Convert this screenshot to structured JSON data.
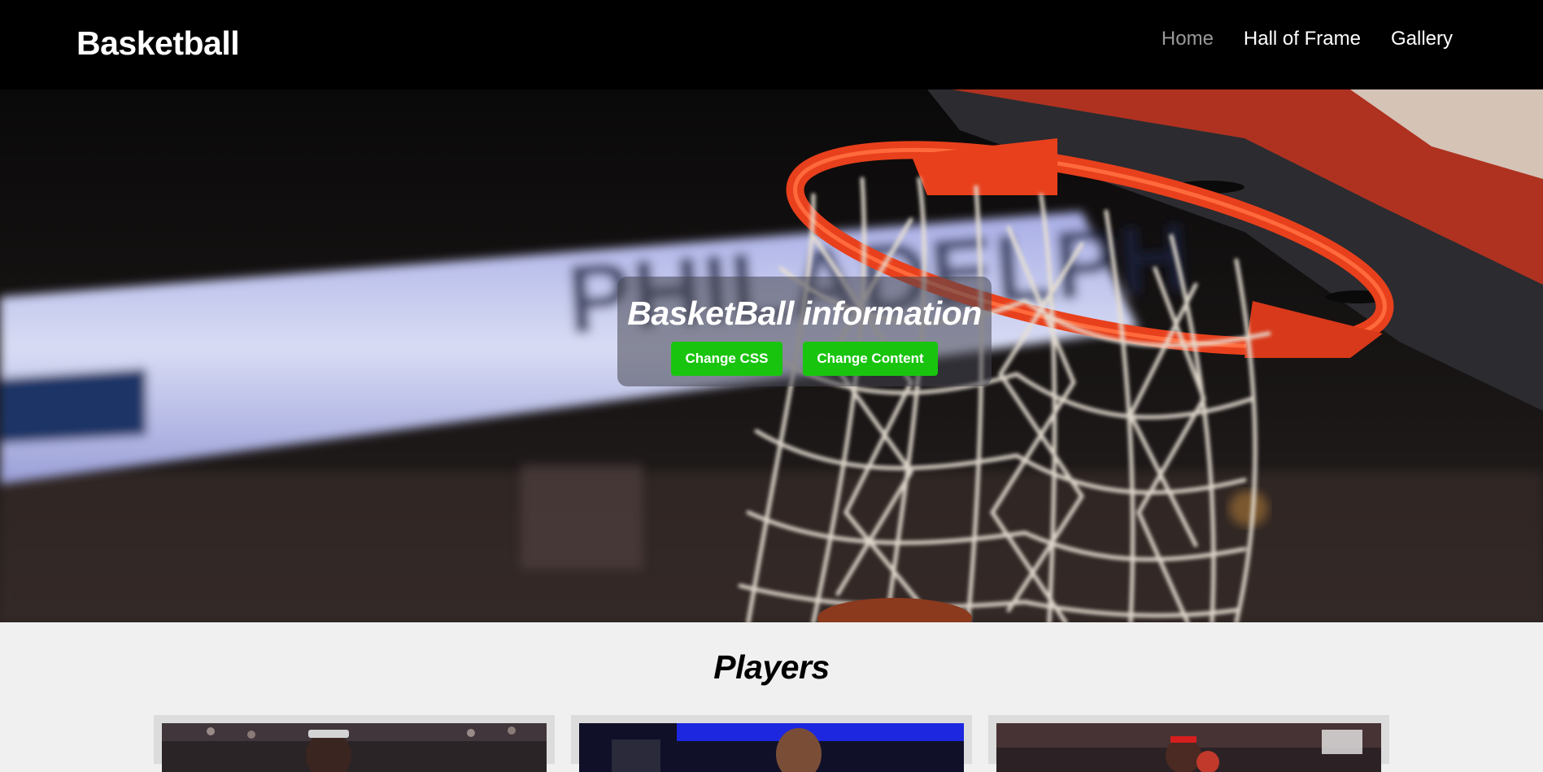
{
  "navbar": {
    "brand": "Basketball",
    "links": [
      {
        "label": "Home",
        "active": true
      },
      {
        "label": "Hall of Frame",
        "active": false
      },
      {
        "label": "Gallery",
        "active": false
      }
    ]
  },
  "hero": {
    "title": "BasketBall information",
    "buttons": {
      "change_css": "Change CSS",
      "change_content": "Change Content"
    },
    "image": "basketball-hoop-net-photo"
  },
  "players": {
    "title": "Players",
    "cards": [
      {
        "image": "player-photo-1"
      },
      {
        "image": "player-photo-2"
      },
      {
        "image": "player-photo-3"
      }
    ]
  },
  "colors": {
    "navbar_bg": "#000000",
    "nav_active": "#999999",
    "button_green": "#19c40f",
    "page_bg": "#f0f0f0",
    "rim_orange": "#e8401c"
  }
}
